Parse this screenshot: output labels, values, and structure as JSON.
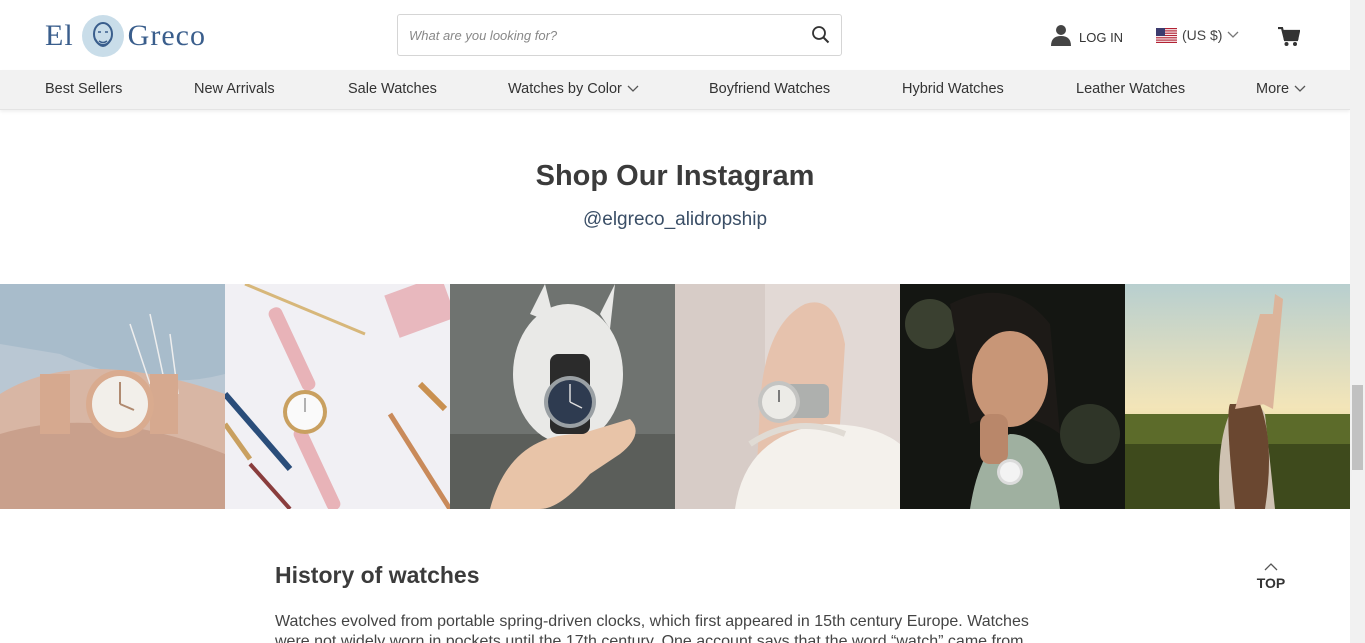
{
  "header": {
    "logo": {
      "left": "El",
      "right": "Greco"
    },
    "search": {
      "placeholder": "What are you looking for?",
      "icon": "search-icon"
    },
    "login_label": "LOG IN",
    "currency_label": "(US $)",
    "cart_icon": "cart-icon"
  },
  "nav": {
    "items": [
      {
        "label": "Best Sellers"
      },
      {
        "label": "New Arrivals"
      },
      {
        "label": "Sale Watches"
      },
      {
        "label": "Watches by Color",
        "dropdown": true
      },
      {
        "label": "Boyfriend Watches"
      },
      {
        "label": "Hybrid Watches"
      },
      {
        "label": "Leather Watches"
      },
      {
        "label": "More",
        "dropdown": true
      }
    ]
  },
  "instagram": {
    "title": "Shop Our Instagram",
    "handle": "@elgreco_alidropship"
  },
  "history": {
    "title": "History of watches",
    "text": "Watches evolved from portable spring-driven clocks, which first appeared in 15th century Europe. Watches were not widely worn in pockets until the 17th century. One account says that the word “watch” came from"
  },
  "top_button": {
    "label": "TOP"
  }
}
